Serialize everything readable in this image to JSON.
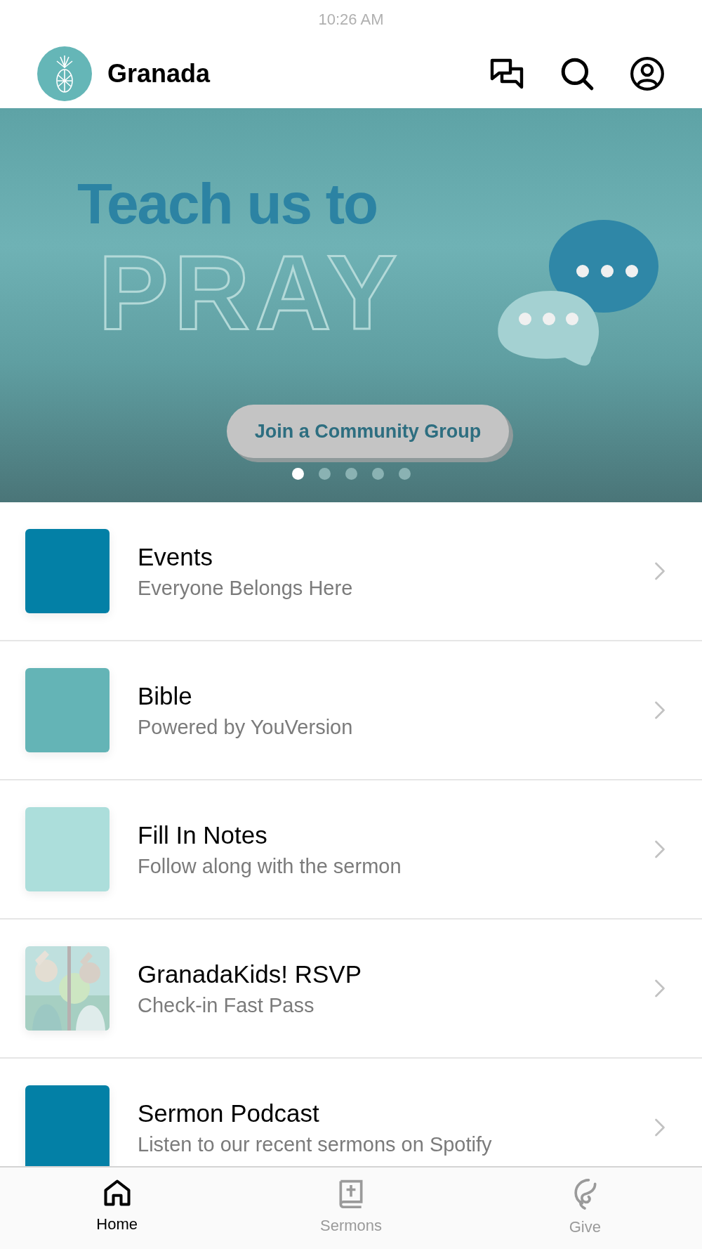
{
  "status_bar": {
    "time": "10:26 AM"
  },
  "header": {
    "title": "Granada"
  },
  "banner": {
    "headline": "Teach us to",
    "big_word": "PRAY",
    "button": "Join a Community Group",
    "dots": [
      {
        "selected": true
      },
      {
        "selected": false
      },
      {
        "selected": false
      },
      {
        "selected": false
      },
      {
        "selected": false
      }
    ]
  },
  "items": [
    {
      "title": "Events",
      "subtitle": "Everyone Belongs Here",
      "kind": "swatch",
      "color": "#0380a6"
    },
    {
      "title": "Bible",
      "subtitle": "Powered by YouVersion",
      "kind": "swatch",
      "color": "#64b4b6"
    },
    {
      "title": "Fill In Notes",
      "subtitle": "Follow along with the sermon",
      "kind": "swatch",
      "color": "#acdedb"
    },
    {
      "title": "GranadaKids! RSVP",
      "subtitle": "Check-in Fast Pass",
      "kind": "picture"
    },
    {
      "title": "Sermon Podcast",
      "subtitle": "Listen to our recent sermons on Spotify",
      "kind": "swatch",
      "color": "#0380a6"
    }
  ],
  "tabs": [
    {
      "label": "Home",
      "kind": "home",
      "selected": true
    },
    {
      "label": "Sermons",
      "kind": "book",
      "selected": false
    },
    {
      "label": "Give",
      "kind": "give",
      "selected": false
    }
  ]
}
